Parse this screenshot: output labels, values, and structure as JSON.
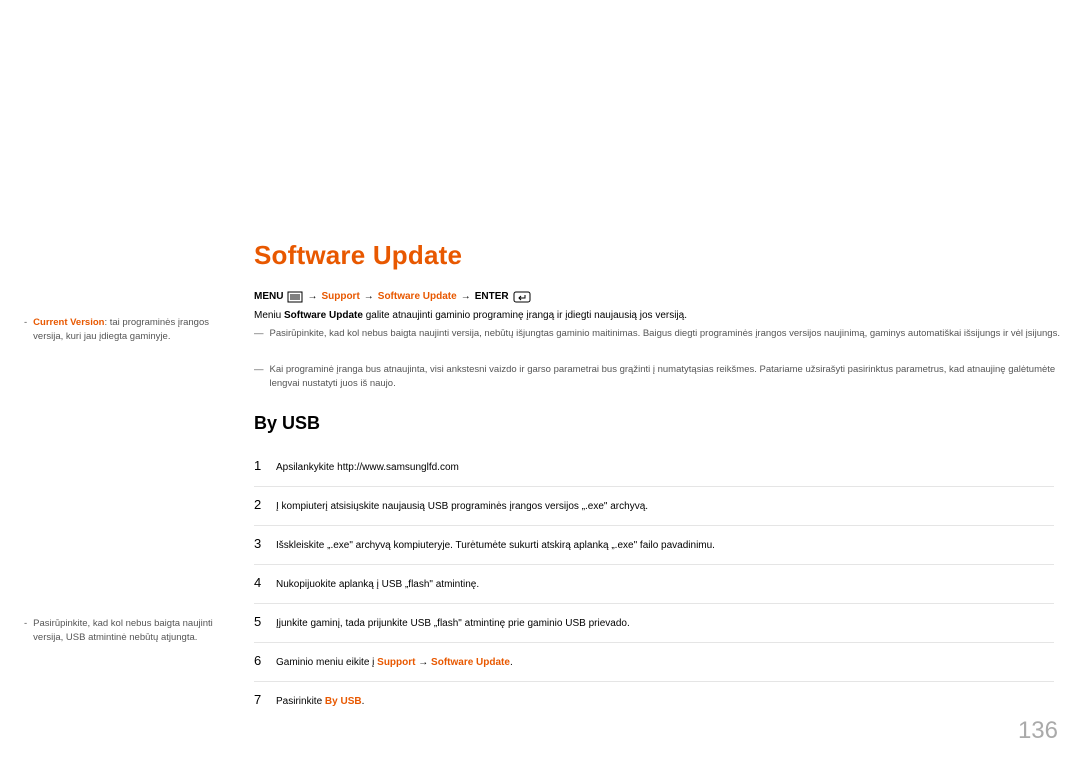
{
  "title": "Software Update",
  "breadcrumb": {
    "menu": "MENU",
    "support": "Support",
    "software_update": "Software Update",
    "enter": "ENTER"
  },
  "intro": {
    "prefix": "Meniu ",
    "bold": "Software Update",
    "suffix": " galite atnaujinti gaminio programinę įrangą ir įdiegti naujausią jos versiją."
  },
  "notes": {
    "n1": "Pasirūpinkite, kad kol nebus baigta naujinti versija, nebūtų išjungtas gaminio maitinimas. Baigus diegti programinės įrangos versijos naujinimą, gaminys automatiškai išsijungs ir vėl įsijungs.",
    "n2": "Kai programinė įranga bus atnaujinta, visi ankstesni vaizdo ir garso parametrai bus grąžinti į numatytąsias reikšmes. Patariame užsirašyti pasirinktus parametrus, kad atnaujinę galėtumėte lengvai nustatyti juos iš naujo."
  },
  "section": "By USB",
  "steps": {
    "s1": {
      "num": "1",
      "text": "Apsilankykite http://www.samsunglfd.com"
    },
    "s2": {
      "num": "2",
      "text": "Į kompiuterį atsisiųskite naujausią USB programinės įrangos versijos „.exe\" archyvą."
    },
    "s3": {
      "num": "3",
      "text": "Išskleiskite „.exe\" archyvą kompiuteryje. Turėtumėte sukurti atskirą aplanką „.exe\" failo pavadinimu."
    },
    "s4": {
      "num": "4",
      "text": "Nukopijuokite aplanką į USB „flash\" atmintinę."
    },
    "s5": {
      "num": "5",
      "text": "Įjunkite gaminį, tada prijunkite USB „flash\" atmintinę prie gaminio USB prievado."
    },
    "s6": {
      "num": "6",
      "prefix": "Gaminio meniu eikite į ",
      "h1": "Support",
      "arrow": " → ",
      "h2": "Software Update",
      "suffix": "."
    },
    "s7": {
      "num": "7",
      "prefix": "Pasirinkite ",
      "h1": "By USB",
      "suffix": "."
    }
  },
  "sidebar": {
    "s1": {
      "prefix": "",
      "highlight": "Current Version",
      "suffix": ": tai programinės įrangos versija, kuri jau įdiegta gaminyje."
    },
    "s2": "Pasirūpinkite, kad kol nebus baigta naujinti versija, USB atmintinė nebūtų atjungta."
  },
  "page_number": "136"
}
